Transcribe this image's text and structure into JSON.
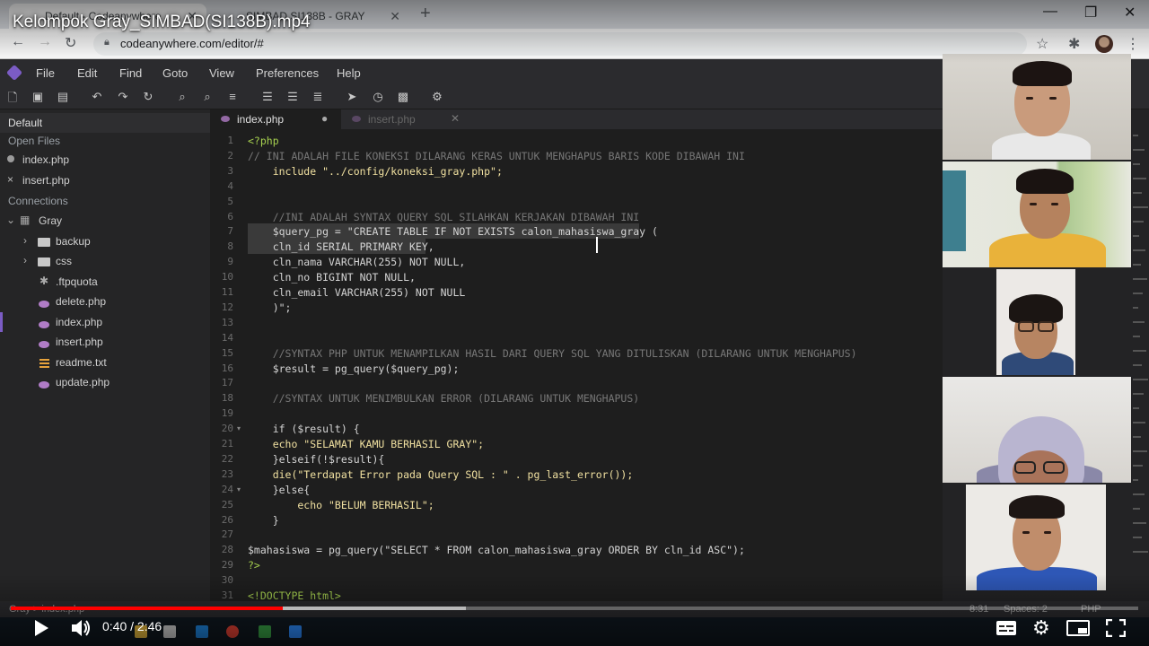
{
  "video": {
    "title": "Kelompok Gray_SIMBAD(SI138B).mp4",
    "current_time": "0:40",
    "separator": "/",
    "duration": "2:46",
    "progress_fraction": 0.241,
    "buffered_fraction": 0.404
  },
  "browser": {
    "tabs": [
      {
        "label": "Default - Codeanywhere",
        "close": "✕"
      },
      {
        "label": "SIMBAD SI138B - GRAY",
        "close": "✕"
      }
    ],
    "new_tab": "+",
    "url": "codeanywhere.com/editor/#",
    "window_controls": [
      "—",
      "❐",
      "✕"
    ]
  },
  "app": {
    "menu": [
      "File",
      "Edit",
      "Find",
      "Goto",
      "View",
      "Preferences",
      "Help"
    ],
    "toolbar_icons": [
      "new-file-icon",
      "save-icon",
      "save-all-icon",
      "undo-icon",
      "redo-icon",
      "refresh-icon",
      "search-icon",
      "search-replace-icon",
      "list-icon",
      "indent-icon",
      "outdent-icon",
      "format-icon",
      "run-icon",
      "history-icon",
      "preview-icon",
      "settings-icon"
    ],
    "accent": "#7b5cc4"
  },
  "sidebar": {
    "workspace": "Default",
    "open_files_label": "Open Files",
    "open_files": [
      {
        "name": "index.php",
        "marker": "●"
      },
      {
        "name": "insert.php",
        "marker": "×"
      }
    ],
    "connections_label": "Connections",
    "connection": "Gray",
    "tree": [
      {
        "name": "backup",
        "type": "folder",
        "arrow": "›"
      },
      {
        "name": "css",
        "type": "folder",
        "arrow": "›"
      },
      {
        "name": ".ftpquota",
        "type": "config"
      },
      {
        "name": "delete.php",
        "type": "php"
      },
      {
        "name": "index.php",
        "type": "php"
      },
      {
        "name": "insert.php",
        "type": "php"
      },
      {
        "name": "readme.txt",
        "type": "txt"
      },
      {
        "name": "update.php",
        "type": "php"
      }
    ]
  },
  "editor": {
    "tabs": [
      {
        "label": "index.php",
        "state": "●"
      },
      {
        "label": "insert.php",
        "state": "✕"
      }
    ],
    "lines": [
      {
        "n": "1",
        "text": "<?php"
      },
      {
        "n": "2",
        "text": "// INI ADALAH FILE KONEKSI DILARANG KERAS UNTUK MENGHAPUS BARIS KODE DIBAWAH INI"
      },
      {
        "n": "3",
        "text": "    include \"../config/koneksi_gray.php\";"
      },
      {
        "n": "4",
        "text": ""
      },
      {
        "n": "5",
        "text": ""
      },
      {
        "n": "6",
        "text": "    //INI ADALAH SYNTAX QUERY SQL SILAHKAN KERJAKAN DIBAWAH INI"
      },
      {
        "n": "7",
        "text": "    $query_pg = \"CREATE TABLE IF NOT EXISTS calon_mahasiswa_gray ("
      },
      {
        "n": "8",
        "text": "    cln_id SERIAL PRIMARY KEY,"
      },
      {
        "n": "9",
        "text": "    cln_nama VARCHAR(255) NOT NULL,"
      },
      {
        "n": "10",
        "text": "    cln_no BIGINT NOT NULL,"
      },
      {
        "n": "11",
        "text": "    cln_email VARCHAR(255) NOT NULL"
      },
      {
        "n": "12",
        "text": "    )\";"
      },
      {
        "n": "13",
        "text": ""
      },
      {
        "n": "14",
        "text": ""
      },
      {
        "n": "15",
        "text": "    //SYNTAX PHP UNTUK MENAMPILKAN HASIL DARI QUERY SQL YANG DITULISKAN (DILARANG UNTUK MENGHAPUS)"
      },
      {
        "n": "16",
        "text": "    $result = pg_query($query_pg);"
      },
      {
        "n": "17",
        "text": ""
      },
      {
        "n": "18",
        "text": "    //SYNTAX UNTUK MENIMBULKAN ERROR (DILARANG UNTUK MENGHAPUS)"
      },
      {
        "n": "19",
        "text": ""
      },
      {
        "n": "20",
        "text": "    if ($result) {"
      },
      {
        "n": "21",
        "text": "    echo \"SELAMAT KAMU BERHASIL GRAY\";"
      },
      {
        "n": "22",
        "text": "    }elseif(!$result){"
      },
      {
        "n": "23",
        "text": "    die(\"Terdapat Error pada Query SQL : \" . pg_last_error());"
      },
      {
        "n": "24",
        "text": "    }else{"
      },
      {
        "n": "25",
        "text": "        echo \"BELUM BERHASIL\";"
      },
      {
        "n": "26",
        "text": "    }"
      },
      {
        "n": "27",
        "text": ""
      },
      {
        "n": "28",
        "text": "$mahasiswa = pg_query(\"SELECT * FROM calon_mahasiswa_gray ORDER BY cln_id ASC\");"
      },
      {
        "n": "29",
        "text": "?>"
      },
      {
        "n": "30",
        "text": ""
      },
      {
        "n": "31",
        "text": "<!DOCTYPE html>"
      }
    ]
  },
  "statusbar": {
    "path": "Gray > index.php",
    "position": "8:31",
    "spaces": "Spaces: 2",
    "language": "PHP"
  }
}
